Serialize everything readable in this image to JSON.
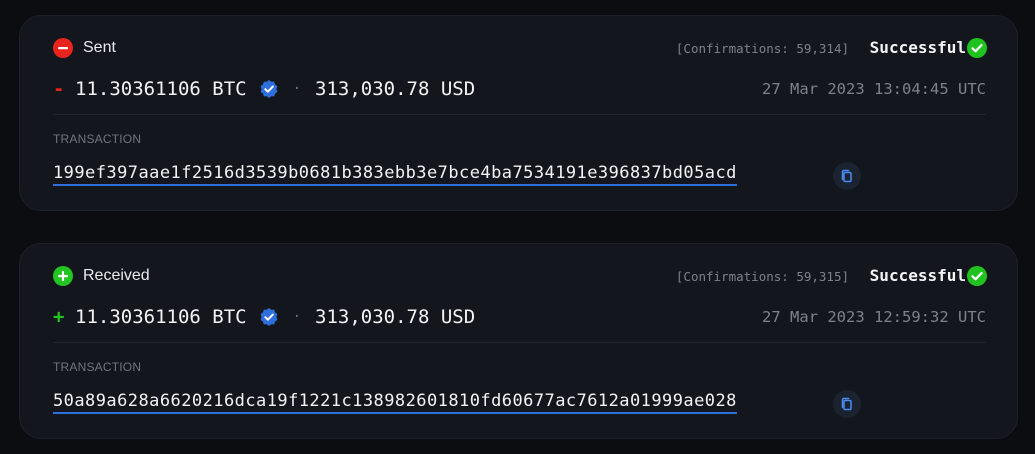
{
  "colors": {
    "sent": "#e8241c",
    "received": "#22c522",
    "success": "#1fc21f",
    "verified": "#2f6fdb",
    "link_underline": "#2f6fdb"
  },
  "transactions": [
    {
      "direction_icon": "minus-circle-icon",
      "direction_label": "Sent",
      "confirmations": "[Confirmations: 59,314]",
      "status": "Successful",
      "sign": "-",
      "amount": "11.30361106 BTC",
      "separator": "·",
      "fiat": "313,030.78 USD",
      "timestamp": "27 Mar 2023 13:04:45 UTC",
      "tx_label": "TRANSACTION",
      "tx_hash": "199ef397aae1f2516d3539b0681b383ebb3e7bce4ba7534191e396837bd05acd"
    },
    {
      "direction_icon": "plus-circle-icon",
      "direction_label": "Received",
      "confirmations": "[Confirmations: 59,315]",
      "status": "Successful",
      "sign": "+",
      "amount": "11.30361106 BTC",
      "separator": "·",
      "fiat": "313,030.78 USD",
      "timestamp": "27 Mar 2023 12:59:32 UTC",
      "tx_label": "TRANSACTION",
      "tx_hash": "50a89a628a6620216dca19f1221c138982601810fd60677ac7612a01999ae028"
    }
  ]
}
